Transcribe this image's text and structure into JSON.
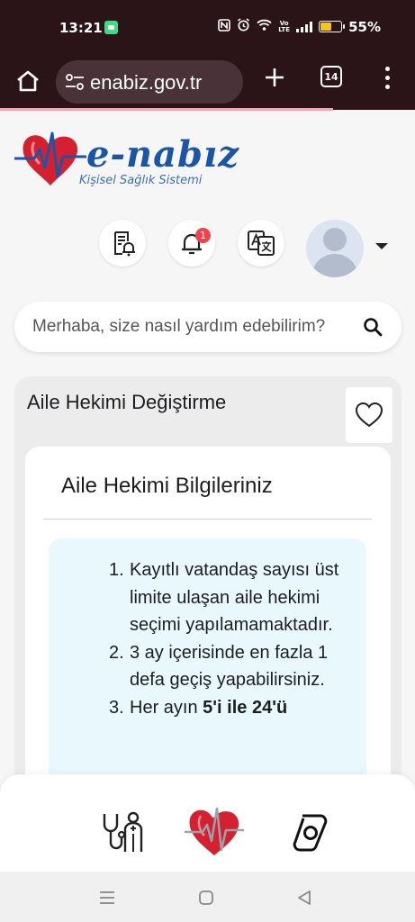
{
  "status_bar": {
    "time": "13:21",
    "battery_percent": "55%",
    "battery_level": 0.55,
    "network_label_top": "Vo",
    "network_label_bottom": "LTE"
  },
  "browser": {
    "url": "enabiz.gov.tr",
    "tab_count": "14"
  },
  "logo": {
    "wordmark": "e-nabız",
    "subtitle": "Kişisel Sağlık Sistemi"
  },
  "header": {
    "notification_count": "1"
  },
  "search": {
    "placeholder": "Merhaba, size nasıl yardım edebilirim?"
  },
  "card": {
    "title": "Aile Hekimi Değiştirme",
    "inner_title": "Aile Hekimi Bilgileriniz",
    "rules": [
      {
        "num": "1.",
        "text": "Kayıtlı vatandaş sayısı üst limite ulaşan aile hekimi seçimi yapılamamaktadır."
      },
      {
        "num": "2.",
        "text": "3 ay içerisinde en fazla 1 defa geçiş yapabilirsiniz."
      },
      {
        "num": "3.",
        "text": "Her ayın ",
        "bold": "5'i ile 24'ü"
      }
    ]
  },
  "colors": {
    "brand_blue": "#1b55a8",
    "brand_red": "#d4202f",
    "browser_bar": "#2a1418",
    "badge_red": "#f0424b",
    "info_box_bg": "#e8f8fd"
  },
  "icons": {
    "header": [
      "document-bell-icon",
      "bell-icon",
      "translate-icon",
      "user-avatar-icon"
    ],
    "bottom_nav": [
      "doctor-icon",
      "enabiz-heart-icon",
      "camera-lens-icon"
    ]
  }
}
